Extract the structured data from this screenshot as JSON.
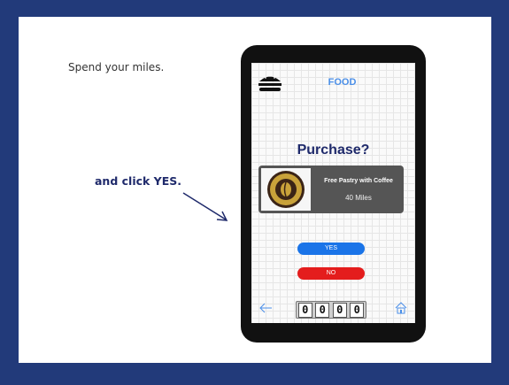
{
  "caption": {
    "instruction": "Spend your miles.",
    "action": "and click YES."
  },
  "phone": {
    "header_title": "FOOD",
    "prompt": "Purchase?",
    "offer": {
      "name": "Free Pastry with Coffee",
      "cost": "40 Miles",
      "logo_icon": "coffee-cafe-logo"
    },
    "yes_label": "YES",
    "no_label": "NO",
    "miles_counter": [
      "0",
      "0",
      "0",
      "0"
    ],
    "icons": {
      "menu": "burger-icon",
      "back": "back-arrow-icon",
      "home": "home-icon"
    }
  },
  "colors": {
    "frame": "#223a7a",
    "header_text": "#4b8fe8",
    "prompt_text": "#1f2a6b",
    "yes": "#1a74e8",
    "no": "#e41d1d"
  }
}
